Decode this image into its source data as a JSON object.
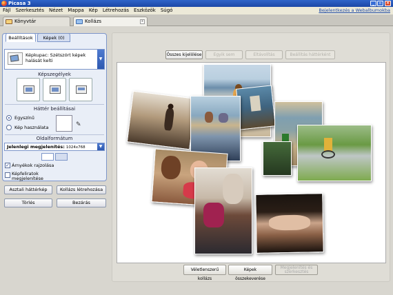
{
  "window": {
    "title": "Picasa 3",
    "min": "_",
    "max": "▫",
    "close": "×"
  },
  "menu": {
    "items": [
      "Fájl",
      "Szerkesztés",
      "Nézet",
      "Mappa",
      "Kép",
      "Létrehozás",
      "Eszközök",
      "Súgó"
    ],
    "signin_link": "Bejelentkezés a Webalbumokba"
  },
  "tabs": {
    "library": "Könyvtár",
    "collage": "Kollázs",
    "close_glyph": "x"
  },
  "panel": {
    "tab_settings": "Beállítások",
    "tab_images": "Képek (0)",
    "collage_type": "Képkupac: Szétszórt képek halását kelti",
    "dropdown_glyph": "▼",
    "borders_title": "Képszegélyek",
    "background_title": "Háttér beállításai",
    "bg_solid": "Egyszínű",
    "bg_image": "Kép használata",
    "eyedropper_glyph": "✎",
    "format_title": "Oldalformátum",
    "format_label": "Jelenlegi megjelenítés:",
    "format_value": "1024x768",
    "shadows_label": "Árnyékok rajzolása",
    "shadows_checked": true,
    "captions_label": "Képfeliratok megjelenítése",
    "captions_checked": false,
    "btn_desktop": "Asztali háttérkép",
    "btn_create": "Kollázs létrehozása",
    "btn_delete": "Törlés",
    "btn_close": "Bezárás"
  },
  "modes": [
    "Összes kijelölése",
    "Egyik sem",
    "Eltávolítás",
    "Beállítás háttérként"
  ],
  "active_mode_index": 0,
  "bottom": {
    "shuffle": "Véletlenszerű kollázs",
    "mix": "Képek összekeverése",
    "edit_line1": "Megjelenítés és",
    "edit_line2": "szerkesztés"
  }
}
